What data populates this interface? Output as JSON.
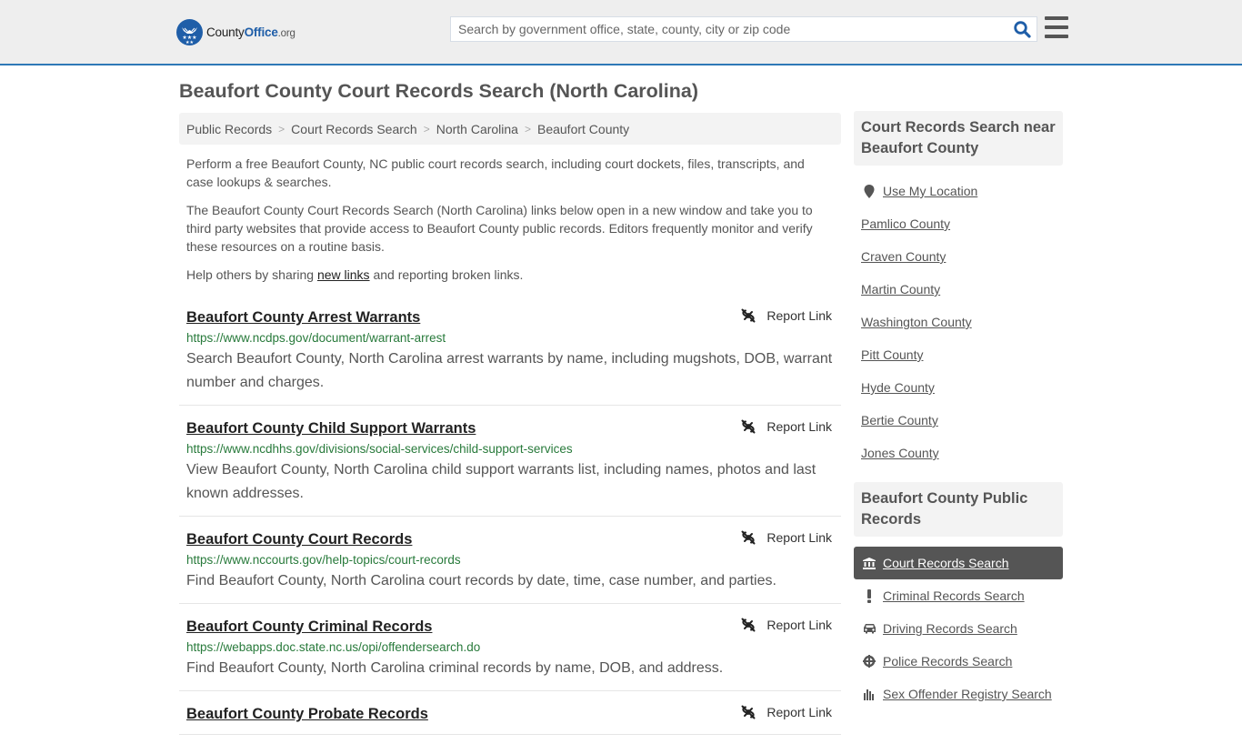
{
  "header": {
    "logo": {
      "name": "County",
      "name_bold": "Office",
      "tld": ".org"
    },
    "search": {
      "placeholder": "Search by government office, state, county, city or zip code",
      "value": ""
    },
    "accent_color": "#2e78b6"
  },
  "page": {
    "title": "Beaufort County Court Records Search (North Carolina)"
  },
  "breadcrumb": [
    {
      "label": "Public Records"
    },
    {
      "label": "Court Records Search"
    },
    {
      "label": "North Carolina"
    },
    {
      "label": "Beaufort County"
    }
  ],
  "intro": {
    "p1": "Perform a free Beaufort County, NC public court records search, including court dockets, files, transcripts, and case lookups & searches.",
    "p2": "The Beaufort County Court Records Search (North Carolina) links below open in a new window and take you to third party websites that provide access to Beaufort County public records. Editors frequently monitor and verify these resources on a routine basis.",
    "p3_before": "Help others by sharing ",
    "p3_link": "new links",
    "p3_after": " and reporting broken links."
  },
  "records": [
    {
      "title": "Beaufort County Arrest Warrants",
      "url": "https://www.ncdps.gov/document/warrant-arrest",
      "description": "Search Beaufort County, North Carolina arrest warrants by name, including mugshots, DOB, warrant number and charges.",
      "report_label": "Report Link"
    },
    {
      "title": "Beaufort County Child Support Warrants",
      "url": "https://www.ncdhhs.gov/divisions/social-services/child-support-services",
      "description": "View Beaufort County, North Carolina child support warrants list, including names, photos and last known addresses.",
      "report_label": "Report Link"
    },
    {
      "title": "Beaufort County Court Records",
      "url": "https://www.nccourts.gov/help-topics/court-records",
      "description": "Find Beaufort County, North Carolina court records by date, time, case number, and parties.",
      "report_label": "Report Link"
    },
    {
      "title": "Beaufort County Criminal Records",
      "url": "https://webapps.doc.state.nc.us/opi/offendersearch.do",
      "description": "Find Beaufort County, North Carolina criminal records by name, DOB, and address.",
      "report_label": "Report Link"
    },
    {
      "title": "Beaufort County Probate Records",
      "url": "",
      "description": "",
      "report_label": "Report Link"
    }
  ],
  "sidebar": {
    "nearby": {
      "heading": "Court Records Search near Beaufort County",
      "use_location": "Use My Location",
      "counties": [
        "Pamlico County",
        "Craven County",
        "Martin County",
        "Washington County",
        "Pitt County",
        "Hyde County",
        "Bertie County",
        "Jones County"
      ]
    },
    "public_records": {
      "heading": "Beaufort County Public Records",
      "items": [
        {
          "label": "Court Records Search",
          "icon": "courthouse-icon",
          "active": true
        },
        {
          "label": "Criminal Records Search",
          "icon": "exclamation-icon",
          "active": false
        },
        {
          "label": "Driving Records Search",
          "icon": "car-icon",
          "active": false
        },
        {
          "label": "Police Records Search",
          "icon": "police-badge-icon",
          "active": false
        },
        {
          "label": "Sex Offender Registry Search",
          "icon": "sex-offender-icon",
          "active": false
        }
      ]
    }
  }
}
